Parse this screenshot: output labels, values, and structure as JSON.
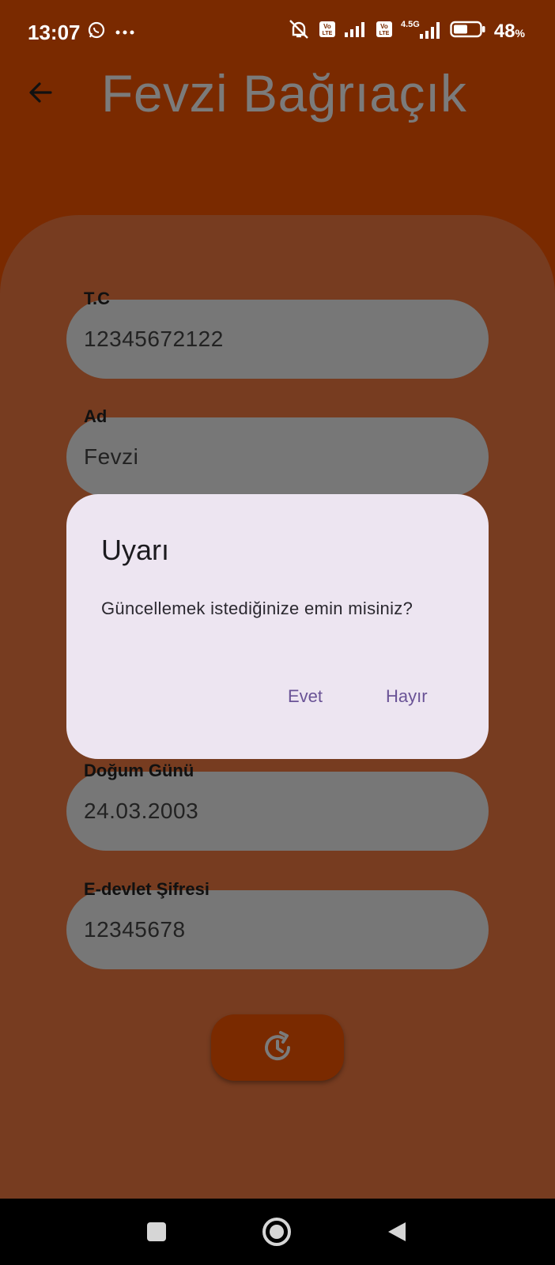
{
  "status": {
    "time": "13:07",
    "battery": "48",
    "battery_unit": "%",
    "network": "4.5G",
    "volte": "Vo\nLTE"
  },
  "header": {
    "title": "Fevzi Bağrıaçık",
    "back_icon": "arrow-left-icon"
  },
  "form": {
    "fields": [
      {
        "label": "T.C",
        "value": "12345672122"
      },
      {
        "label": "Ad",
        "value": "Fevzi"
      },
      {
        "label": "Doğum Günü",
        "value": "24.03.2003"
      },
      {
        "label": "E-devlet Şifresi",
        "value": "12345678"
      }
    ],
    "refresh_icon": "refresh-clock-icon"
  },
  "dialog": {
    "title": "Uyarı",
    "message": "Güncellemek istediğinize emin misiniz?",
    "confirm_label": "Evet",
    "cancel_label": "Hayır"
  },
  "nav": {
    "recents_icon": "square-icon",
    "home_icon": "circle-icon",
    "back_icon": "triangle-back-icon"
  },
  "colors": {
    "app_bar": "#7a2a00",
    "card": "#773c20",
    "field": "#777777",
    "dialog": "#ede5f1",
    "accent": "#6a5396"
  }
}
